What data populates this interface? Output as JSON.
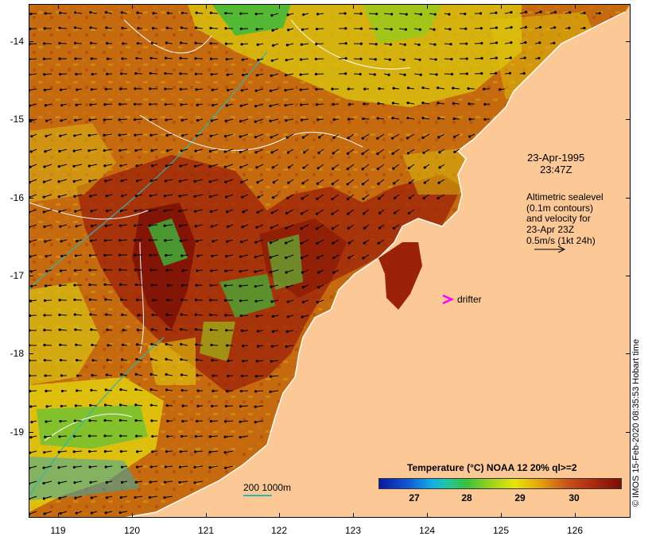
{
  "map": {
    "datetime_line1": "23-Apr-1995",
    "datetime_line2": "23:47Z",
    "legend_lines": [
      "Altimetric sealevel",
      "(0.1m contours)",
      "and velocity for",
      "23-Apr 23Z",
      "0.5m/s (1kt 24h)"
    ],
    "drifter_label": "drifter",
    "drifter_color": "#ff00ff",
    "scale_label": "200 1000m",
    "credit": "© IMOS 15-Feb-2020 08:35:53 Hobart time",
    "land_color": "#fcc896",
    "contour_color": "#ffffff",
    "bathymetry_color": "#2ab8b0",
    "arrow_color": "#000000"
  },
  "axes": {
    "y_labels": [
      "-14",
      "-15",
      "-16",
      "-17",
      "-18",
      "-19"
    ],
    "x_labels": [
      "119",
      "120",
      "121",
      "122",
      "123",
      "124",
      "125",
      "126"
    ]
  },
  "colorbar": {
    "title": "Temperature (°C) NOAA 12 20% ql>=2",
    "labels": [
      "27",
      "28",
      "29",
      "30"
    ],
    "range": [
      26.4,
      30.7
    ]
  }
}
